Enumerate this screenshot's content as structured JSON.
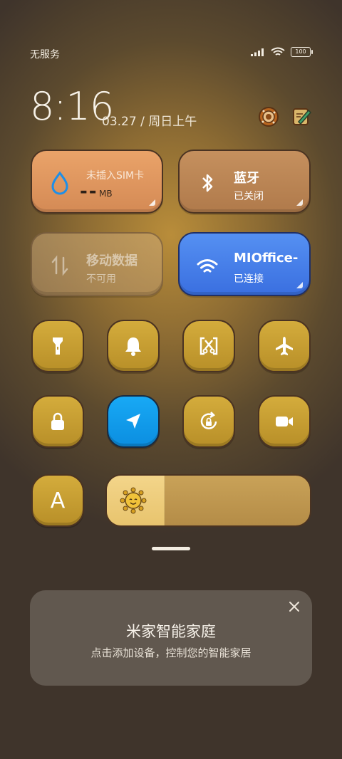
{
  "status": {
    "carrier": "无服务",
    "battery": "100"
  },
  "clock": {
    "time": "8:16",
    "date": "03.27 / 周日上午"
  },
  "tiles": {
    "sim": {
      "title": "未插入SIM卡",
      "value": "--",
      "unit": "MB"
    },
    "bluetooth": {
      "title": "蓝牙",
      "subtitle": "已关闭"
    },
    "mobile_data": {
      "title": "移动数据",
      "subtitle": "不可用"
    },
    "wifi": {
      "title": "MIOffice-",
      "subtitle": "已连接"
    }
  },
  "toggles": [
    {
      "id": "flashlight",
      "icon": "flashlight-icon"
    },
    {
      "id": "mute",
      "icon": "bell-icon"
    },
    {
      "id": "screenshot",
      "icon": "screenshot-scissors-icon"
    },
    {
      "id": "airplane",
      "icon": "airplane-icon"
    },
    {
      "id": "lock",
      "icon": "lock-icon"
    },
    {
      "id": "location",
      "icon": "location-arrow-icon",
      "active": true
    },
    {
      "id": "auto-rotate",
      "icon": "rotation-lock-icon"
    },
    {
      "id": "screen-record",
      "icon": "video-camera-icon"
    }
  ],
  "auto_brightness": {
    "label": "A"
  },
  "brightness": {
    "level": 0.28
  },
  "home_card": {
    "title": "米家智能家庭",
    "subtitle": "点击添加设备，控制您的智能家居"
  },
  "colors": {
    "accent_blue": "#3a6fe0",
    "location_active": "#0b8ee0",
    "toggle_gold": "#c9a032"
  }
}
